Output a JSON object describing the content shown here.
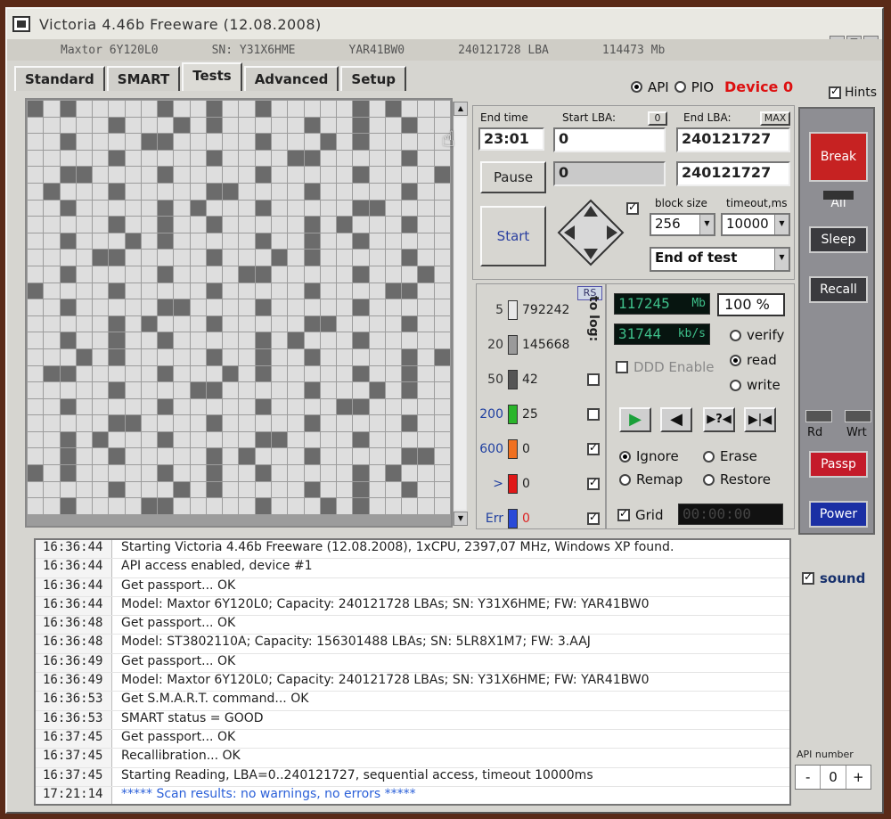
{
  "window": {
    "title": "Victoria 4.46b Freeware (12.08.2008)"
  },
  "infobar": {
    "model": "Maxtor 6Y120L0",
    "serial": "SN: Y31X6HME",
    "firmware": "YAR41BW0",
    "lba": "240121728 LBA",
    "size": "114473 Mb"
  },
  "tabs": [
    "Standard",
    "SMART",
    "Tests",
    "Advanced",
    "Setup"
  ],
  "active_tab": "Tests",
  "mode": {
    "api": "API",
    "pio": "PIO",
    "device": "Device 0",
    "hints": "Hints"
  },
  "test": {
    "end_time_label": "End time",
    "end_time": "23:01",
    "start_lba_label": "Start LBA:",
    "start_lba_btn": "0",
    "start_lba": "0",
    "start_lba_current": "0",
    "end_lba_label": "End LBA:",
    "max_btn": "MAX",
    "end_lba": "240121727",
    "end_lba_current": "240121727",
    "pause": "Pause",
    "start": "Start",
    "block_size_label": "block size",
    "block_size": "256",
    "timeout_label": "timeout,ms",
    "timeout": "10000",
    "end_action": "End of test"
  },
  "stats": {
    "rs": "RS",
    "to_log": "to log:",
    "rows": [
      {
        "t": "5",
        "v": "792242",
        "color": "#e8e8e8"
      },
      {
        "t": "20",
        "v": "145668",
        "color": "#9a9a9a"
      },
      {
        "t": "50",
        "v": "42",
        "color": "#555555"
      },
      {
        "t": "200",
        "v": "25",
        "color": "#2ab52a"
      },
      {
        "t": "600",
        "v": "0",
        "color": "#f07020"
      },
      {
        "t": ">",
        "v": "0",
        "color": "#e01818"
      },
      {
        "t": "Err",
        "v": "0",
        "color": "#2a4ad8"
      }
    ]
  },
  "speed": {
    "mb": "117245",
    "mb_unit": "Mb",
    "pct": "100",
    "pct_unit": "%",
    "kbs": "31744",
    "kbs_unit": "kb/s",
    "ddd": "DDD Enable",
    "verify": "verify",
    "read": "read",
    "write": "write",
    "ignore": "Ignore",
    "erase": "Erase",
    "remap": "Remap",
    "restore": "Restore",
    "grid": "Grid",
    "timer": "00:00:00"
  },
  "right": {
    "break_all": "Break All",
    "sleep": "Sleep",
    "recall": "Recall",
    "rd": "Rd",
    "wrt": "Wrt",
    "passp": "Passp",
    "power": "Power"
  },
  "log": [
    {
      "time": "16:36:44",
      "msg": "Starting Victoria 4.46b Freeware (12.08.2008), 1xCPU, 2397,07 MHz, Windows XP found."
    },
    {
      "time": "16:36:44",
      "msg": "API access enabled, device #1"
    },
    {
      "time": "16:36:44",
      "msg": "Get passport... OK"
    },
    {
      "time": "16:36:44",
      "msg": "Model: Maxtor 6Y120L0; Capacity: 240121728 LBAs; SN: Y31X6HME; FW: YAR41BW0"
    },
    {
      "time": "16:36:48",
      "msg": "Get passport... OK"
    },
    {
      "time": "16:36:48",
      "msg": "Model: ST3802110A; Capacity: 156301488 LBAs; SN: 5LR8X1M7; FW: 3.AAJ"
    },
    {
      "time": "16:36:49",
      "msg": "Get passport... OK"
    },
    {
      "time": "16:36:49",
      "msg": "Model: Maxtor 6Y120L0; Capacity: 240121728 LBAs; SN: Y31X6HME; FW: YAR41BW0"
    },
    {
      "time": "16:36:53",
      "msg": "Get S.M.A.R.T. command... OK"
    },
    {
      "time": "16:36:53",
      "msg": "SMART status = GOOD"
    },
    {
      "time": "16:37:45",
      "msg": "Get passport... OK"
    },
    {
      "time": "16:37:45",
      "msg": "Recallibration... OK"
    },
    {
      "time": "16:37:45",
      "msg": "Starting Reading, LBA=0..240121727, sequential access, timeout 10000ms"
    },
    {
      "time": "17:21:14",
      "msg": "***** Scan results: no warnings, no errors *****",
      "blue": true
    }
  ],
  "sound": "sound",
  "api_number": {
    "label": "API number",
    "value": "0",
    "minus": "-",
    "plus": "+"
  }
}
